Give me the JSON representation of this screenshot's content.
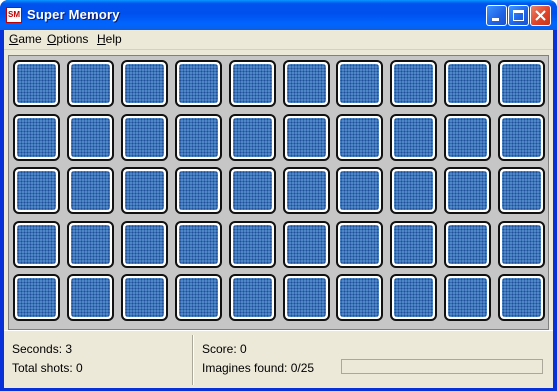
{
  "window": {
    "title": "Super Memory",
    "icon": "super-memory-app-icon",
    "icon_text": "SM"
  },
  "menu": {
    "items": [
      "Game",
      "Options",
      "Help"
    ]
  },
  "board": {
    "rows": 5,
    "columns": 10,
    "card_state": "face-down",
    "card_back_color": "#4d87c7"
  },
  "status": {
    "seconds_label": "Seconds:",
    "seconds_value": "3",
    "total_shots_label": "Total shots:",
    "total_shots_value": "0",
    "score_label": "Score:",
    "score_value": "0",
    "images_found_label": "Imagines found:",
    "images_found_value": "0/25",
    "progress_fraction": 0
  },
  "colors": {
    "title_bar": "#0053ee",
    "close_button": "#e0442a",
    "client_background": "#ece9d8",
    "board_background": "#c6c6c6"
  }
}
